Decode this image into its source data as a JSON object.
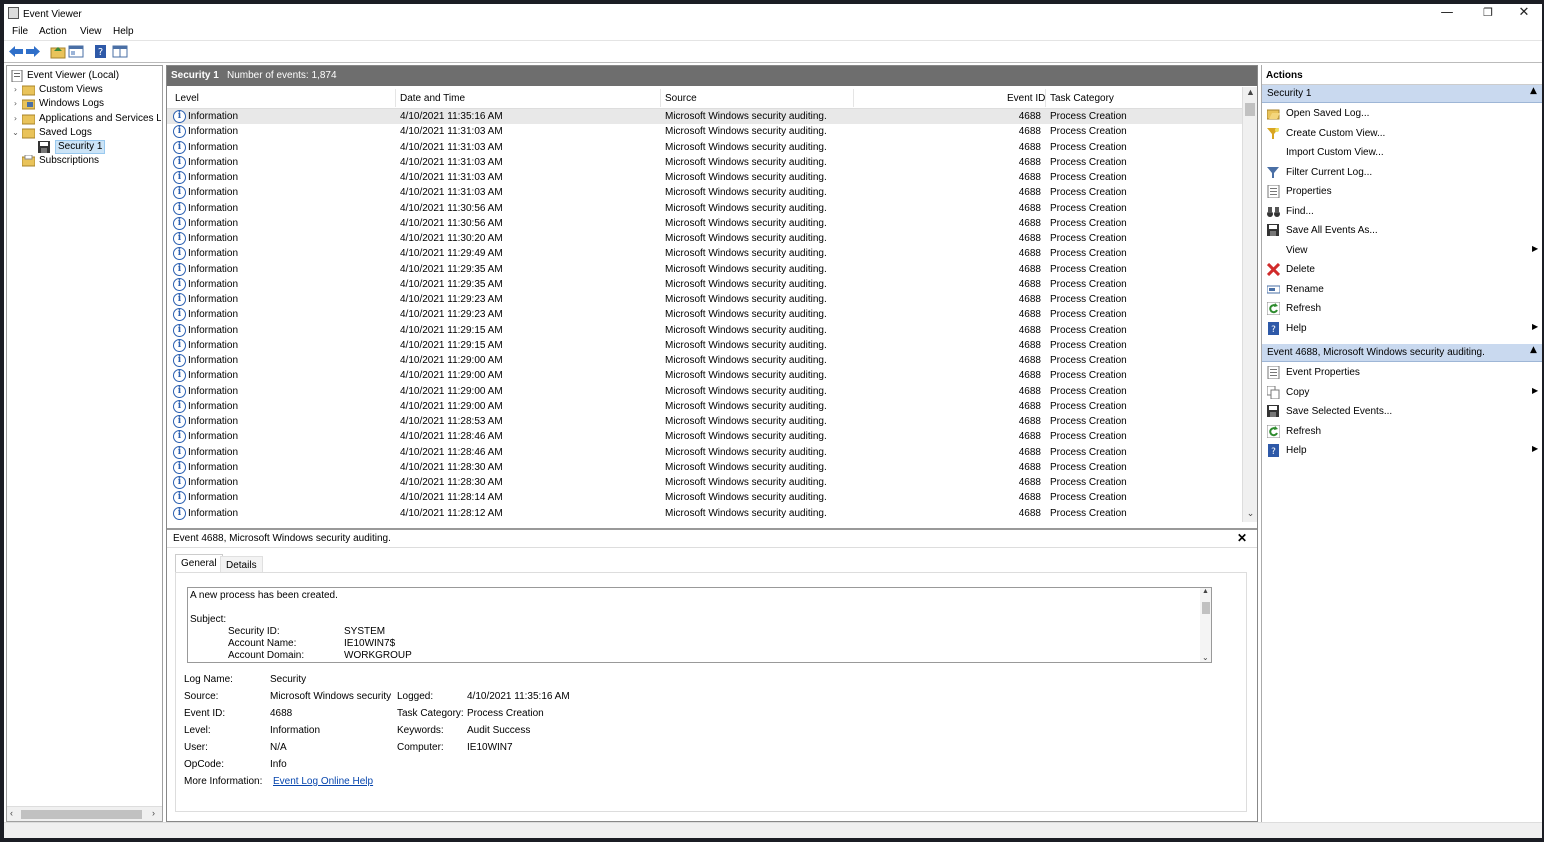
{
  "window": {
    "title": "Event Viewer",
    "minimize": "—",
    "restore": "❐",
    "close": "✕"
  },
  "menu": [
    "File",
    "Action",
    "View",
    "Help"
  ],
  "toolbar": [
    "back-icon",
    "forward-icon",
    "up-folder-icon",
    "show-hide-tree-icon",
    "help-icon",
    "console-icon"
  ],
  "tree": {
    "items": [
      {
        "label": "Event Viewer (Local)",
        "icon": "event-viewer-icon",
        "twisty": "",
        "indent": 0
      },
      {
        "label": "Custom Views",
        "icon": "folder-icon",
        "twisty": "›",
        "indent": 1
      },
      {
        "label": "Windows Logs",
        "icon": "folder-icon",
        "twisty": "›",
        "indent": 1
      },
      {
        "label": "Applications and Services Lo",
        "icon": "folder-icon",
        "twisty": "›",
        "indent": 1
      },
      {
        "label": "Saved Logs",
        "icon": "folder-icon",
        "twisty": "⌄",
        "indent": 1
      },
      {
        "label": "Security 1",
        "icon": "saved-log-icon",
        "twisty": "",
        "indent": 2,
        "selected": true
      },
      {
        "label": "Subscriptions",
        "icon": "subscriptions-icon",
        "twisty": "",
        "indent": 1
      }
    ]
  },
  "log": {
    "name": "Security 1",
    "count_text": "Number of events: 1,874"
  },
  "columns": [
    "Level",
    "Date and Time",
    "Source",
    "Event ID",
    "Task Category"
  ],
  "events": [
    [
      "Information",
      "4/10/2021 11:35:16 AM",
      "Microsoft Windows security auditing.",
      "4688",
      "Process Creation"
    ],
    [
      "Information",
      "4/10/2021 11:31:03 AM",
      "Microsoft Windows security auditing.",
      "4688",
      "Process Creation"
    ],
    [
      "Information",
      "4/10/2021 11:31:03 AM",
      "Microsoft Windows security auditing.",
      "4688",
      "Process Creation"
    ],
    [
      "Information",
      "4/10/2021 11:31:03 AM",
      "Microsoft Windows security auditing.",
      "4688",
      "Process Creation"
    ],
    [
      "Information",
      "4/10/2021 11:31:03 AM",
      "Microsoft Windows security auditing.",
      "4688",
      "Process Creation"
    ],
    [
      "Information",
      "4/10/2021 11:31:03 AM",
      "Microsoft Windows security auditing.",
      "4688",
      "Process Creation"
    ],
    [
      "Information",
      "4/10/2021 11:30:56 AM",
      "Microsoft Windows security auditing.",
      "4688",
      "Process Creation"
    ],
    [
      "Information",
      "4/10/2021 11:30:56 AM",
      "Microsoft Windows security auditing.",
      "4688",
      "Process Creation"
    ],
    [
      "Information",
      "4/10/2021 11:30:20 AM",
      "Microsoft Windows security auditing.",
      "4688",
      "Process Creation"
    ],
    [
      "Information",
      "4/10/2021 11:29:49 AM",
      "Microsoft Windows security auditing.",
      "4688",
      "Process Creation"
    ],
    [
      "Information",
      "4/10/2021 11:29:35 AM",
      "Microsoft Windows security auditing.",
      "4688",
      "Process Creation"
    ],
    [
      "Information",
      "4/10/2021 11:29:35 AM",
      "Microsoft Windows security auditing.",
      "4688",
      "Process Creation"
    ],
    [
      "Information",
      "4/10/2021 11:29:23 AM",
      "Microsoft Windows security auditing.",
      "4688",
      "Process Creation"
    ],
    [
      "Information",
      "4/10/2021 11:29:23 AM",
      "Microsoft Windows security auditing.",
      "4688",
      "Process Creation"
    ],
    [
      "Information",
      "4/10/2021 11:29:15 AM",
      "Microsoft Windows security auditing.",
      "4688",
      "Process Creation"
    ],
    [
      "Information",
      "4/10/2021 11:29:15 AM",
      "Microsoft Windows security auditing.",
      "4688",
      "Process Creation"
    ],
    [
      "Information",
      "4/10/2021 11:29:00 AM",
      "Microsoft Windows security auditing.",
      "4688",
      "Process Creation"
    ],
    [
      "Information",
      "4/10/2021 11:29:00 AM",
      "Microsoft Windows security auditing.",
      "4688",
      "Process Creation"
    ],
    [
      "Information",
      "4/10/2021 11:29:00 AM",
      "Microsoft Windows security auditing.",
      "4688",
      "Process Creation"
    ],
    [
      "Information",
      "4/10/2021 11:29:00 AM",
      "Microsoft Windows security auditing.",
      "4688",
      "Process Creation"
    ],
    [
      "Information",
      "4/10/2021 11:28:53 AM",
      "Microsoft Windows security auditing.",
      "4688",
      "Process Creation"
    ],
    [
      "Information",
      "4/10/2021 11:28:46 AM",
      "Microsoft Windows security auditing.",
      "4688",
      "Process Creation"
    ],
    [
      "Information",
      "4/10/2021 11:28:46 AM",
      "Microsoft Windows security auditing.",
      "4688",
      "Process Creation"
    ],
    [
      "Information",
      "4/10/2021 11:28:30 AM",
      "Microsoft Windows security auditing.",
      "4688",
      "Process Creation"
    ],
    [
      "Information",
      "4/10/2021 11:28:30 AM",
      "Microsoft Windows security auditing.",
      "4688",
      "Process Creation"
    ],
    [
      "Information",
      "4/10/2021 11:28:14 AM",
      "Microsoft Windows security auditing.",
      "4688",
      "Process Creation"
    ],
    [
      "Information",
      "4/10/2021 11:28:12 AM",
      "Microsoft Windows security auditing.",
      "4688",
      "Process Creation"
    ]
  ],
  "detail": {
    "title": "Event 4688, Microsoft Windows security auditing.",
    "close": "✕",
    "tabs": [
      "General",
      "Details"
    ],
    "description": {
      "line1": "A new process has been created.",
      "subject_label": "Subject:",
      "fields": [
        [
          "Security ID:",
          "SYSTEM"
        ],
        [
          "Account Name:",
          "IE10WIN7$"
        ],
        [
          "Account Domain:",
          "WORKGROUP"
        ]
      ]
    },
    "left_fields": [
      [
        "Log Name:",
        "Security"
      ],
      [
        "Source:",
        "Microsoft Windows security"
      ],
      [
        "Event ID:",
        "4688"
      ],
      [
        "Level:",
        "Information"
      ],
      [
        "User:",
        "N/A"
      ],
      [
        "OpCode:",
        "Info"
      ],
      [
        "More Information:",
        "Event Log Online Help"
      ]
    ],
    "right_fields": [
      [
        "Logged:",
        "4/10/2021 11:35:16 AM"
      ],
      [
        "Task Category:",
        "Process Creation"
      ],
      [
        "Keywords:",
        "Audit Success"
      ],
      [
        "Computer:",
        "IE10WIN7"
      ]
    ]
  },
  "actions": {
    "header": "Actions",
    "groups": [
      {
        "title": "Security 1",
        "items": [
          {
            "label": "Open Saved Log...",
            "icon": "open-folder-icon"
          },
          {
            "label": "Create Custom View...",
            "icon": "filter-create-icon"
          },
          {
            "label": "Import Custom View...",
            "icon": ""
          },
          {
            "label": "Filter Current Log...",
            "icon": "filter-icon"
          },
          {
            "label": "Properties",
            "icon": "properties-icon"
          },
          {
            "label": "Find...",
            "icon": "binoculars-icon"
          },
          {
            "label": "Save All Events As...",
            "icon": "save-icon"
          },
          {
            "label": "View",
            "icon": "",
            "submenu": true
          },
          {
            "label": "Delete",
            "icon": "delete-icon"
          },
          {
            "label": "Rename",
            "icon": "rename-icon"
          },
          {
            "label": "Refresh",
            "icon": "refresh-icon"
          },
          {
            "label": "Help",
            "icon": "help-icon",
            "submenu": true
          }
        ]
      },
      {
        "title": "Event 4688, Microsoft Windows security auditing.",
        "items": [
          {
            "label": "Event Properties",
            "icon": "properties-icon"
          },
          {
            "label": "Copy",
            "icon": "copy-icon",
            "submenu": true
          },
          {
            "label": "Save Selected Events...",
            "icon": "save-icon"
          },
          {
            "label": "Refresh",
            "icon": "refresh-icon"
          },
          {
            "label": "Help",
            "icon": "help-icon",
            "submenu": true
          }
        ]
      }
    ]
  },
  "colors": {
    "group_header": "#c9d9ef",
    "grid_header": "#6e6e6e",
    "link": "#0645ad",
    "info": "#2a5fb0",
    "delete": "#d12b2b"
  }
}
